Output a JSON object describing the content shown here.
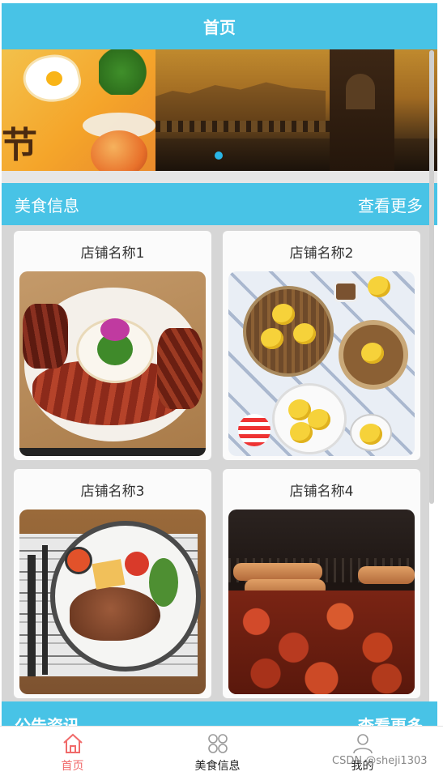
{
  "header": {
    "title": "首页"
  },
  "banner": {
    "left_glyph": "节",
    "accent_color": "#48c3e6",
    "indicator_color": "#29b6e6"
  },
  "food_section": {
    "title": "美食信息",
    "more_label": "查看更多"
  },
  "stores": [
    {
      "name": "店铺名称1"
    },
    {
      "name": "店铺名称2"
    },
    {
      "name": "店铺名称3"
    },
    {
      "name": "店铺名称4"
    }
  ],
  "notice_section": {
    "title": "公告资讯",
    "more_label": "查看更多"
  },
  "tabbar": {
    "items": [
      {
        "label": "首页",
        "icon": "home-icon",
        "active": true
      },
      {
        "label": "美食信息",
        "icon": "grid-icon",
        "active": false
      },
      {
        "label": "我的",
        "icon": "user-icon",
        "active": false
      }
    ],
    "active_color": "#f06a6a"
  },
  "watermark": "CSDN @sheji1303"
}
